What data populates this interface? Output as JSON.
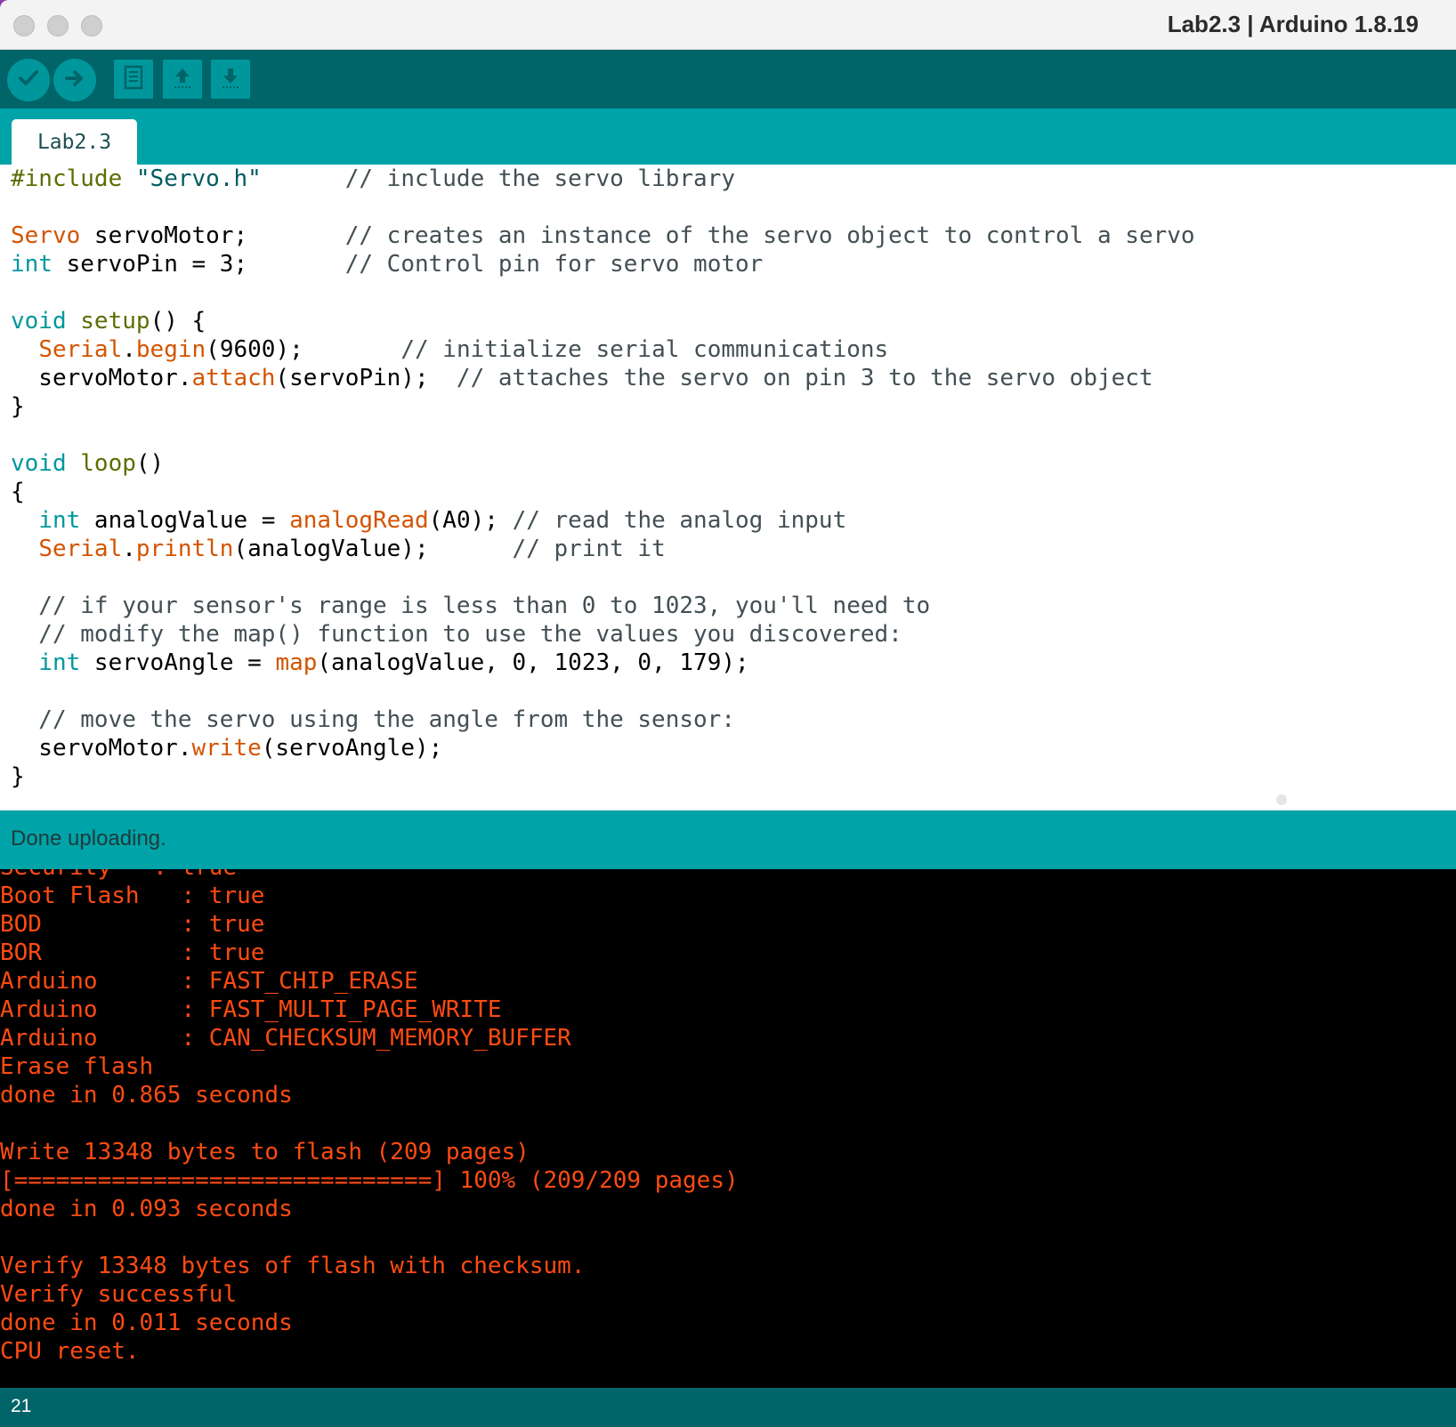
{
  "window": {
    "title": "Lab2.3 | Arduino 1.8.19"
  },
  "toolbar": {
    "buttons": [
      {
        "name": "verify",
        "icon": "checkmark-icon"
      },
      {
        "name": "upload",
        "icon": "arrow-right-icon"
      },
      {
        "name": "new",
        "icon": "document-icon"
      },
      {
        "name": "open",
        "icon": "arrow-up-icon"
      },
      {
        "name": "save",
        "icon": "arrow-down-icon"
      }
    ]
  },
  "tabs": [
    {
      "label": "Lab2.3",
      "active": true
    }
  ],
  "editor": {
    "lines": [
      [
        [
          "pre",
          "#include "
        ],
        [
          "str",
          "\"Servo.h\""
        ],
        [
          "cm",
          "      // include the servo library"
        ]
      ],
      [],
      [
        [
          "fn",
          "Servo"
        ],
        [
          "tx",
          " servoMotor;       "
        ],
        [
          "cm",
          "// creates an instance of the servo object to control a servo"
        ]
      ],
      [
        [
          "kw",
          "int"
        ],
        [
          "tx",
          " servoPin = 3;       "
        ],
        [
          "cm",
          "// Control pin for servo motor"
        ]
      ],
      [],
      [
        [
          "kw",
          "void"
        ],
        [
          "tx",
          " "
        ],
        [
          "fn2",
          "setup"
        ],
        [
          "tx",
          "() {"
        ]
      ],
      [
        [
          "tx",
          "  "
        ],
        [
          "fn",
          "Serial"
        ],
        [
          "tx",
          "."
        ],
        [
          "fn",
          "begin"
        ],
        [
          "tx",
          "(9600);       "
        ],
        [
          "cm",
          "// initialize serial communications"
        ]
      ],
      [
        [
          "tx",
          "  servoMotor."
        ],
        [
          "fn",
          "attach"
        ],
        [
          "tx",
          "(servoPin);  "
        ],
        [
          "cm",
          "// attaches the servo on pin 3 to the servo object"
        ]
      ],
      [
        [
          "tx",
          "}"
        ]
      ],
      [],
      [
        [
          "kw",
          "void"
        ],
        [
          "tx",
          " "
        ],
        [
          "fn2",
          "loop"
        ],
        [
          "tx",
          "()"
        ]
      ],
      [
        [
          "tx",
          "{"
        ]
      ],
      [
        [
          "tx",
          "  "
        ],
        [
          "kw",
          "int"
        ],
        [
          "tx",
          " analogValue = "
        ],
        [
          "fn",
          "analogRead"
        ],
        [
          "tx",
          "(A0); "
        ],
        [
          "cm",
          "// read the analog input"
        ]
      ],
      [
        [
          "tx",
          "  "
        ],
        [
          "fn",
          "Serial"
        ],
        [
          "tx",
          "."
        ],
        [
          "fn",
          "println"
        ],
        [
          "tx",
          "(analogValue);      "
        ],
        [
          "cm",
          "// print it"
        ]
      ],
      [],
      [
        [
          "cm",
          "  // if your sensor's range is less than 0 to 1023, you'll need to"
        ]
      ],
      [
        [
          "cm",
          "  // modify the map() function to use the values you discovered:"
        ]
      ],
      [
        [
          "tx",
          "  "
        ],
        [
          "kw",
          "int"
        ],
        [
          "tx",
          " servoAngle = "
        ],
        [
          "fn",
          "map"
        ],
        [
          "tx",
          "(analogValue, 0, 1023, 0, 179);"
        ]
      ],
      [],
      [
        [
          "cm",
          "  // move the servo using the angle from the sensor:"
        ]
      ],
      [
        [
          "tx",
          "  servoMotor."
        ],
        [
          "fn",
          "write"
        ],
        [
          "tx",
          "(servoAngle);"
        ]
      ],
      [
        [
          "tx",
          "}"
        ]
      ]
    ]
  },
  "status": {
    "message": "Done uploading."
  },
  "console": {
    "partial_top": "Security   : true",
    "lines": [
      "Boot Flash   : true",
      "BOD          : true",
      "BOR          : true",
      "Arduino      : FAST_CHIP_ERASE",
      "Arduino      : FAST_MULTI_PAGE_WRITE",
      "Arduino      : CAN_CHECKSUM_MEMORY_BUFFER",
      "Erase flash",
      "done in 0.865 seconds",
      "",
      "Write 13348 bytes to flash (209 pages)",
      "[==============================] 100% (209/209 pages)",
      "done in 0.093 seconds",
      "",
      "Verify 13348 bytes of flash with checksum.",
      "Verify successful",
      "done in 0.011 seconds",
      "CPU reset."
    ]
  },
  "footer": {
    "line_number": "21"
  },
  "colors": {
    "toolbar": "#006468",
    "tabbar": "#00a3a8",
    "button": "#00979c",
    "console_text": "#ff4b12"
  }
}
